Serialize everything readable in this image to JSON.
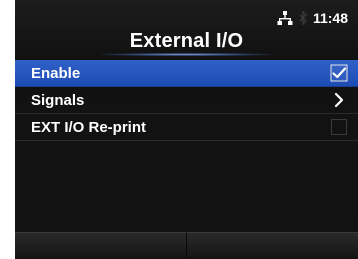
{
  "status_bar": {
    "time": "11:48",
    "network_icon": "network-icon",
    "bluetooth_icon": "bluetooth-icon"
  },
  "screen": {
    "title": "External I/O"
  },
  "menu": {
    "items": [
      {
        "label": "Enable",
        "control": "checkbox",
        "checked": true,
        "selected": true
      },
      {
        "label": "Signals",
        "control": "chevron-right",
        "selected": false
      },
      {
        "label": "EXT I/O Re-print",
        "control": "checkbox",
        "checked": false,
        "selected": false
      }
    ]
  },
  "softkeys": {
    "left_label": "",
    "right_label": ""
  },
  "colors": {
    "selection_blue": "#2f60c8",
    "background": "#111111",
    "text": "#ffffff"
  }
}
